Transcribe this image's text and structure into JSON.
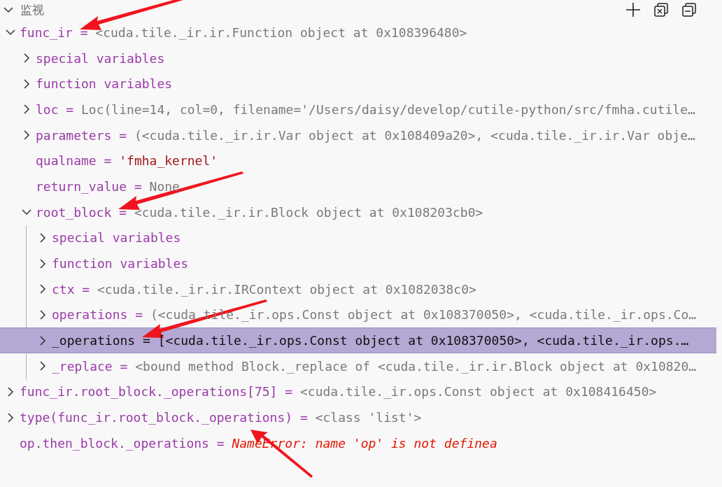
{
  "section": {
    "title": "监视",
    "expanded": true
  },
  "toolbar": [
    {
      "kind": "add"
    },
    {
      "kind": "remove-all"
    },
    {
      "kind": "collapse-all"
    }
  ],
  "watch": [
    {
      "name": "func_ir",
      "separator": "=",
      "value": "<cuda.tile._ir.ir.Function object at 0x108396480>",
      "kind": "object",
      "expandable": true,
      "expanded": true,
      "selected": false,
      "annotation": {
        "kind": "upright"
      },
      "children": [
        {
          "name": "special variables",
          "kind": "group",
          "expandable": true,
          "expanded": false,
          "selected": false
        },
        {
          "name": "function variables",
          "kind": "group",
          "expandable": true,
          "expanded": false,
          "selected": false
        },
        {
          "name": "loc",
          "separator": "=",
          "value": "Loc(line=14, col=0, filename='/Users/daisy/develop/cutile-python/src/fmha.cutile…",
          "kind": "object",
          "expandable": true,
          "expanded": false,
          "selected": false
        },
        {
          "name": "parameters",
          "separator": "=",
          "value": "(<cuda.tile._ir.ir.Var object at 0x108409a20>, <cuda.tile._ir.ir.Var obje…",
          "kind": "object",
          "expandable": true,
          "expanded": false,
          "selected": false
        },
        {
          "name": "qualname",
          "separator": "=",
          "value": "'fmha_kernel'",
          "kind": "string",
          "expandable": false,
          "selected": false
        },
        {
          "name": "return_value",
          "separator": "=",
          "value": "None",
          "kind": "object",
          "expandable": false,
          "selected": false
        },
        {
          "name": "root_block",
          "separator": "=",
          "value": "<cuda.tile._ir.ir.Block object at 0x108203cb0>",
          "kind": "object",
          "expandable": true,
          "expanded": true,
          "selected": false,
          "annotation": {
            "kind": "upright"
          },
          "children": [
            {
              "name": "special variables",
              "kind": "group",
              "expandable": true,
              "expanded": false,
              "selected": false
            },
            {
              "name": "function variables",
              "kind": "group",
              "expandable": true,
              "expanded": false,
              "selected": false
            },
            {
              "name": "ctx",
              "separator": "=",
              "value": "<cuda.tile._ir.ir.IRContext object at 0x1082038c0>",
              "kind": "object",
              "expandable": true,
              "expanded": false,
              "selected": false
            },
            {
              "name": "operations",
              "separator": "=",
              "value": "(<cuda.tile._ir.ops.Const object at 0x108370050>, <cuda.tile._ir.ops.Co…",
              "kind": "object",
              "expandable": true,
              "expanded": false,
              "selected": false
            },
            {
              "name": "_operations",
              "separator": "=",
              "value": "[<cuda.tile._ir.ops.Const object at 0x108370050>, <cuda.tile._ir.ops.…",
              "kind": "object",
              "expandable": true,
              "expanded": false,
              "selected": true,
              "annotation": {
                "kind": "upright"
              }
            },
            {
              "name": "_replace",
              "separator": "=",
              "value": "<bound method Block._replace of <cuda.tile._ir.ir.Block object at 0x10820…",
              "kind": "object",
              "expandable": true,
              "expanded": false,
              "selected": false
            }
          ]
        }
      ]
    },
    {
      "name": "func_ir.root_block._operations[75]",
      "separator": "=",
      "value": "<cuda.tile._ir.ops.Const object at 0x108416450>",
      "kind": "object",
      "expandable": true,
      "expanded": false,
      "selected": false
    },
    {
      "name": "type(func_ir.root_block._operations)",
      "separator": "=",
      "value": "<class 'list'>",
      "kind": "object",
      "expandable": true,
      "expanded": false,
      "selected": false
    },
    {
      "name": "op.then_block._operations",
      "separator": "=",
      "value": "NameError: name 'op' is not definea",
      "kind": "error",
      "expandable": false,
      "selected": false,
      "annotation": {
        "kind": "below"
      }
    }
  ]
}
